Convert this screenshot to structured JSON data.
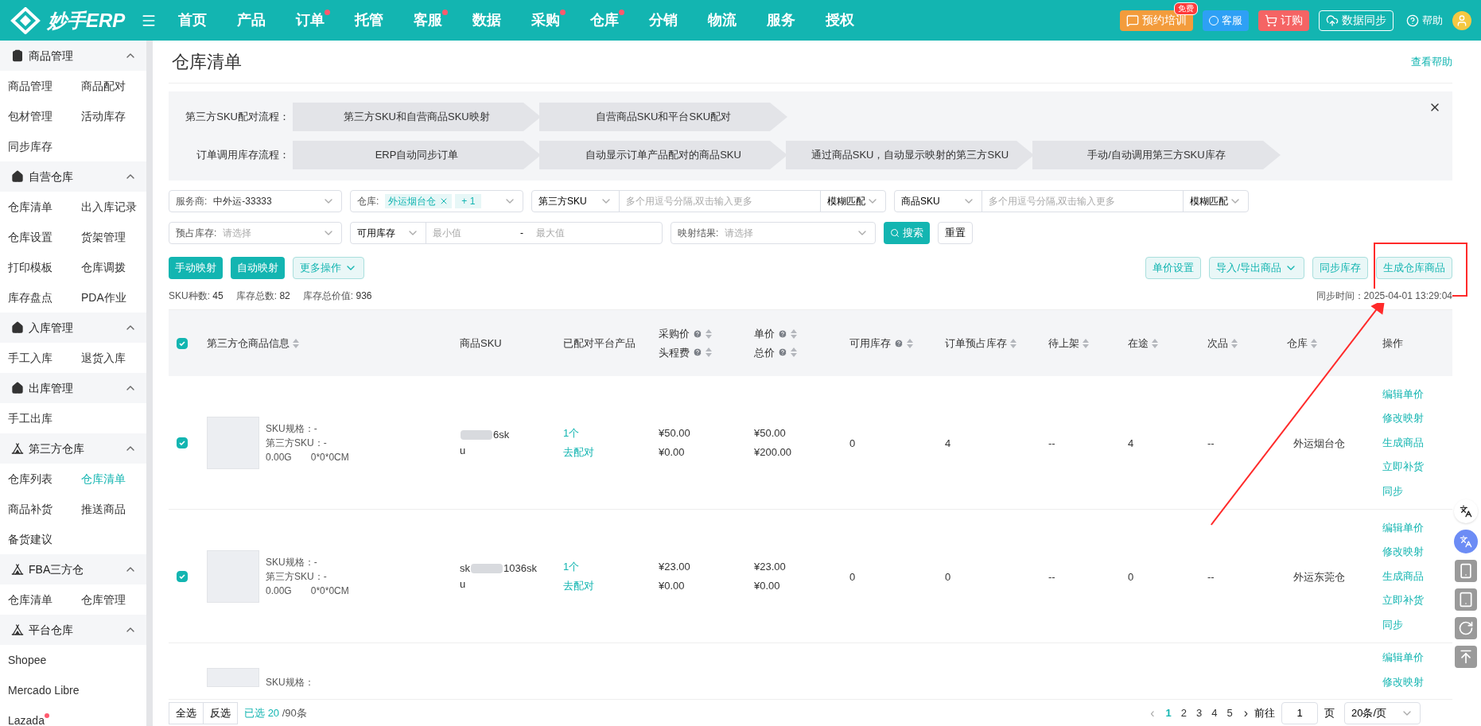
{
  "topbar": {
    "logo": "妙手ERP",
    "nav": [
      {
        "label": "首页",
        "dot": false
      },
      {
        "label": "产品",
        "dot": false
      },
      {
        "label": "订单",
        "dot": true
      },
      {
        "label": "托管",
        "dot": false
      },
      {
        "label": "客服",
        "dot": true
      },
      {
        "label": "数据",
        "dot": false
      },
      {
        "label": "采购",
        "dot": true
      },
      {
        "label": "仓库",
        "dot": true
      },
      {
        "label": "分销",
        "dot": false
      },
      {
        "label": "物流",
        "dot": false
      },
      {
        "label": "服务",
        "dot": false
      },
      {
        "label": "授权",
        "dot": false
      }
    ],
    "training": {
      "label": "预约培训",
      "badge": "免费"
    },
    "service": "客服",
    "order": "订购",
    "sync": "数据同步",
    "help": "帮助"
  },
  "sidebar": [
    {
      "title": "商品管理",
      "expanded": true,
      "items": [
        {
          "label": "商品管理",
          "selected": false
        },
        {
          "label": "商品配对",
          "selected": false
        },
        {
          "label": "包材管理",
          "selected": false
        },
        {
          "label": "活动库存",
          "selected": false
        },
        {
          "label": "同步库存",
          "selected": false
        }
      ]
    },
    {
      "title": "自营仓库",
      "expanded": true,
      "items": [
        {
          "label": "仓库清单",
          "selected": false
        },
        {
          "label": "出入库记录",
          "selected": false
        },
        {
          "label": "仓库设置",
          "selected": false
        },
        {
          "label": "货架管理",
          "selected": false
        },
        {
          "label": "打印模板",
          "selected": false
        },
        {
          "label": "仓库调拨",
          "selected": false
        },
        {
          "label": "库存盘点",
          "selected": false
        },
        {
          "label": "PDA作业",
          "selected": false
        }
      ]
    },
    {
      "title": "入库管理",
      "expanded": true,
      "items": [
        {
          "label": "手工入库",
          "selected": false
        },
        {
          "label": "退货入库",
          "selected": false
        }
      ]
    },
    {
      "title": "出库管理",
      "expanded": true,
      "items": [
        {
          "label": "手工出库",
          "selected": false
        }
      ]
    },
    {
      "title": "第三方仓库",
      "expanded": true,
      "items": [
        {
          "label": "仓库列表",
          "selected": false
        },
        {
          "label": "仓库清单",
          "selected": true
        },
        {
          "label": "商品补货",
          "selected": false
        },
        {
          "label": "推送商品",
          "selected": false
        },
        {
          "label": "备货建议",
          "selected": false
        }
      ]
    },
    {
      "title": "FBA三方仓",
      "expanded": true,
      "items": [
        {
          "label": "仓库清单",
          "selected": false
        },
        {
          "label": "仓库管理",
          "selected": false
        }
      ]
    },
    {
      "title": "平台仓库",
      "expanded": true,
      "wide": true,
      "items": [
        {
          "label": "Shopee",
          "selected": false,
          "dot": false
        },
        {
          "label": "Mercado Libre",
          "selected": false,
          "dot": false
        },
        {
          "label": "Lazada",
          "selected": false,
          "dot": true
        }
      ]
    }
  ],
  "page": {
    "title": "仓库清单",
    "help_link": "查看帮助"
  },
  "flows": [
    {
      "label": "第三方SKU配对流程：",
      "steps": [
        "第三方SKU和自营商品SKU映射",
        "自营商品SKU和平台SKU配对"
      ]
    },
    {
      "label": "订单调用库存流程：",
      "steps": [
        "ERP自动同步订单",
        "自动显示订单产品配对的商品SKU",
        "通过商品SKU，自动显示映射的第三方SKU",
        "手动/自动调用第三方SKU库存"
      ]
    }
  ],
  "filters": {
    "provider": {
      "label": "服务商:",
      "value": "中外运-33333"
    },
    "warehouse": {
      "label": "仓库:",
      "tags": [
        "外运烟台仓"
      ],
      "more": "+ 1"
    },
    "third_sku": {
      "type": "第三方SKU",
      "placeholder": "多个用逗号分隔,双击输入更多",
      "match": "模糊匹配"
    },
    "product_sku": {
      "type": "商品SKU",
      "placeholder": "多个用逗号分隔,双击输入更多",
      "match": "模糊匹配"
    },
    "reserved": {
      "label": "预占库存:",
      "placeholder": "请选择"
    },
    "available": {
      "type": "可用库存",
      "min_placeholder": "最小值",
      "sep": "-",
      "max_placeholder": "最大值"
    },
    "mapping": {
      "label": "映射结果:",
      "placeholder": "请选择"
    },
    "search": "搜索",
    "reset": "重置"
  },
  "actions_left": [
    {
      "label": "手动映射",
      "kind": "primary"
    },
    {
      "label": "自动映射",
      "kind": "primary"
    },
    {
      "label": "更多操作",
      "kind": "dropdown"
    }
  ],
  "actions_right": [
    {
      "label": "单价设置",
      "kind": "plain"
    },
    {
      "label": "导入/导出商品",
      "kind": "dropdown"
    },
    {
      "label": "同步库存",
      "kind": "plain"
    },
    {
      "label": "生成仓库商品",
      "kind": "plain"
    }
  ],
  "summary": [
    {
      "label": "SKU种数:",
      "value": "45"
    },
    {
      "label": "库存总数:",
      "value": "82"
    },
    {
      "label": "库存总价值:",
      "value": "936"
    }
  ],
  "sync_time": "同步时间：2025-04-01 13:29:04",
  "table": {
    "all_checked": true,
    "columns": [
      [
        {
          "text": "第三方仓商品信息",
          "help": false,
          "sort": true
        }
      ],
      [
        {
          "text": "商品SKU",
          "help": false,
          "sort": false
        }
      ],
      [
        {
          "text": "已配对平台产品",
          "help": false,
          "sort": false
        }
      ],
      [
        {
          "text": "采购价",
          "help": true,
          "sort": true
        },
        {
          "text": "头程费",
          "help": true,
          "sort": true
        }
      ],
      [
        {
          "text": "单价",
          "help": true,
          "sort": true
        },
        {
          "text": "总价",
          "help": true,
          "sort": true
        }
      ],
      [
        {
          "text": "可用库存",
          "help": true,
          "sort": true
        }
      ],
      [
        {
          "text": "订单预占库存",
          "help": false,
          "sort": true
        }
      ],
      [
        {
          "text": "待上架",
          "help": false,
          "sort": true
        }
      ],
      [
        {
          "text": "在途",
          "help": false,
          "sort": true
        }
      ],
      [
        {
          "text": "次品",
          "help": false,
          "sort": true
        }
      ],
      [
        {
          "text": "仓库",
          "help": false,
          "sort": true
        }
      ],
      [
        {
          "text": "操作",
          "help": false,
          "sort": false
        }
      ]
    ],
    "rows": [
      {
        "checked": true,
        "spec": "SKU规格：-",
        "third_sku": "第三方SKU：-",
        "weight": "0.00G",
        "size": "0*0*0CM",
        "sku_prefix": "",
        "sku_visible": "6sk",
        "sku_tail": "u",
        "matched": "1个",
        "pair": "去配对",
        "purchase": "¥50.00",
        "freight": "¥0.00",
        "unit": "¥50.00",
        "total": "¥200.00",
        "available": "0",
        "reserved": "4",
        "pending": "--",
        "transit": "4",
        "defective": "--",
        "warehouse": "外运烟台仓",
        "ops": [
          "编辑单价",
          "修改映射",
          "生成商品",
          "立即补货",
          "同步"
        ]
      },
      {
        "checked": true,
        "spec": "SKU规格：-",
        "third_sku": "第三方SKU：-",
        "weight": "0.00G",
        "size": "0*0*0CM",
        "sku_prefix": "sk",
        "sku_visible": "1036sk",
        "sku_tail": "u",
        "matched": "1个",
        "pair": "去配对",
        "purchase": "¥23.00",
        "freight": "¥0.00",
        "unit": "¥23.00",
        "total": "¥0.00",
        "available": "0",
        "reserved": "0",
        "pending": "--",
        "transit": "0",
        "defective": "--",
        "warehouse": "外运东莞仓",
        "ops": [
          "编辑单价",
          "修改映射",
          "生成商品",
          "立即补货",
          "同步"
        ]
      }
    ],
    "partial_row": {
      "spec": "SKU规格：",
      "ops": [
        "编辑单价",
        "修改映射"
      ]
    }
  },
  "footer": {
    "select_all": "全选",
    "invert": "反选",
    "selected_prefix": "已选",
    "selected_count": "20",
    "selected_total": "/90条",
    "prev": "‹",
    "pages": [
      {
        "label": "1",
        "selected": true
      },
      {
        "label": "2",
        "selected": false
      },
      {
        "label": "3",
        "selected": false
      },
      {
        "label": "4",
        "selected": false
      },
      {
        "label": "5",
        "selected": false
      }
    ],
    "next": "›",
    "goto": "前往",
    "page_input": "1",
    "page_unit": "页",
    "page_size": "20条/页"
  }
}
